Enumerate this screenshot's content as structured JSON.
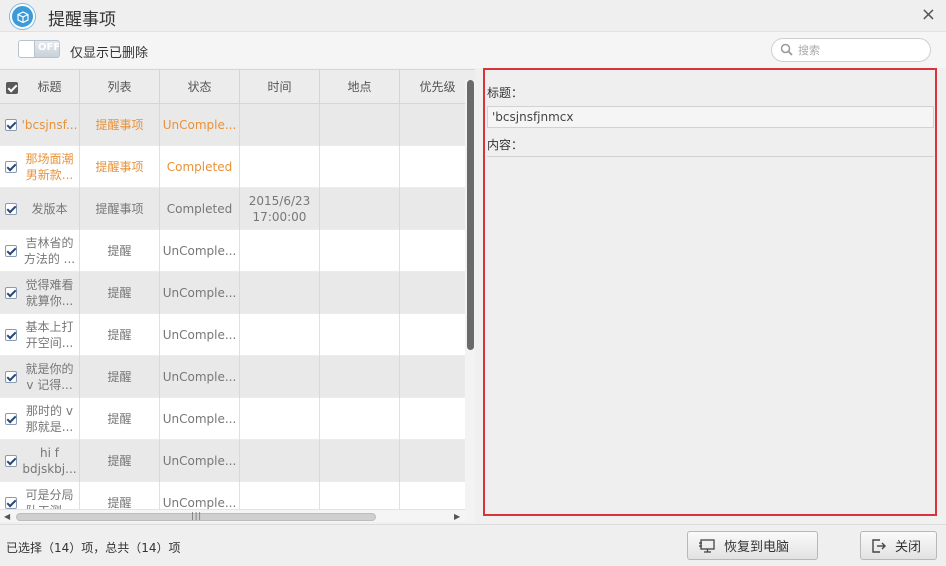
{
  "window": {
    "title": "提醒事项",
    "app_icon": "cube-icon",
    "close_glyph": "×"
  },
  "toolbar": {
    "toggle_text": "OFF",
    "toggle_label": "仅显示已删除",
    "search_placeholder": "搜索"
  },
  "table": {
    "columns": [
      "标题",
      "列表",
      "状态",
      "时间",
      "地点",
      "优先级"
    ],
    "rows": [
      {
        "title": "'bcsjnsf...",
        "list": "提醒事项",
        "status": "UnComple...",
        "time": "",
        "place": "",
        "priority": "",
        "highlight": true,
        "shade": "gray"
      },
      {
        "title": "那场面潮男新款...",
        "list": "提醒事项",
        "status": "Completed",
        "time": "",
        "place": "",
        "priority": "",
        "highlight": true,
        "shade": "white"
      },
      {
        "title": "发版本",
        "list": "提醒事项",
        "status": "Completed",
        "time": "2015/6/23 17:00:00",
        "place": "",
        "priority": "",
        "highlight": false,
        "shade": "gray"
      },
      {
        "title": "吉林省的方法的 ...",
        "list": "提醒",
        "status": "UnComple...",
        "time": "",
        "place": "",
        "priority": "",
        "highlight": false,
        "shade": "white"
      },
      {
        "title": "觉得难看就算你...",
        "list": "提醒",
        "status": "UnComple...",
        "time": "",
        "place": "",
        "priority": "",
        "highlight": false,
        "shade": "gray"
      },
      {
        "title": "基本上打开空间...",
        "list": "提醒",
        "status": "UnComple...",
        "time": "",
        "place": "",
        "priority": "",
        "highlight": false,
        "shade": "white"
      },
      {
        "title": "就是你的 v 记得...",
        "list": "提醒",
        "status": "UnComple...",
        "time": "",
        "place": "",
        "priority": "",
        "highlight": false,
        "shade": "gray"
      },
      {
        "title": "那时的 v 那就是...",
        "list": "提醒",
        "status": "UnComple...",
        "time": "",
        "place": "",
        "priority": "",
        "highlight": false,
        "shade": "white"
      },
      {
        "title": "hi f bdjskbj...",
        "list": "提醒",
        "status": "UnComple...",
        "time": "",
        "place": "",
        "priority": "",
        "highlight": false,
        "shade": "gray"
      },
      {
        "title": "可是分局队工测...",
        "list": "提醒",
        "status": "UnComple...",
        "time": "",
        "place": "",
        "priority": "",
        "highlight": false,
        "shade": "white"
      }
    ]
  },
  "detail": {
    "title_label": "标题：",
    "title_value": "'bcsjnsfjnmcx",
    "content_label": "内容："
  },
  "footer": {
    "status": "已选择（14）项，总共（14）项",
    "restore_label": "恢复到电脑",
    "close_label": "关闭"
  },
  "colors": {
    "highlight_text": "#e8923a",
    "selection_border": "#d7343c",
    "app_icon": "#3d9ad6"
  }
}
